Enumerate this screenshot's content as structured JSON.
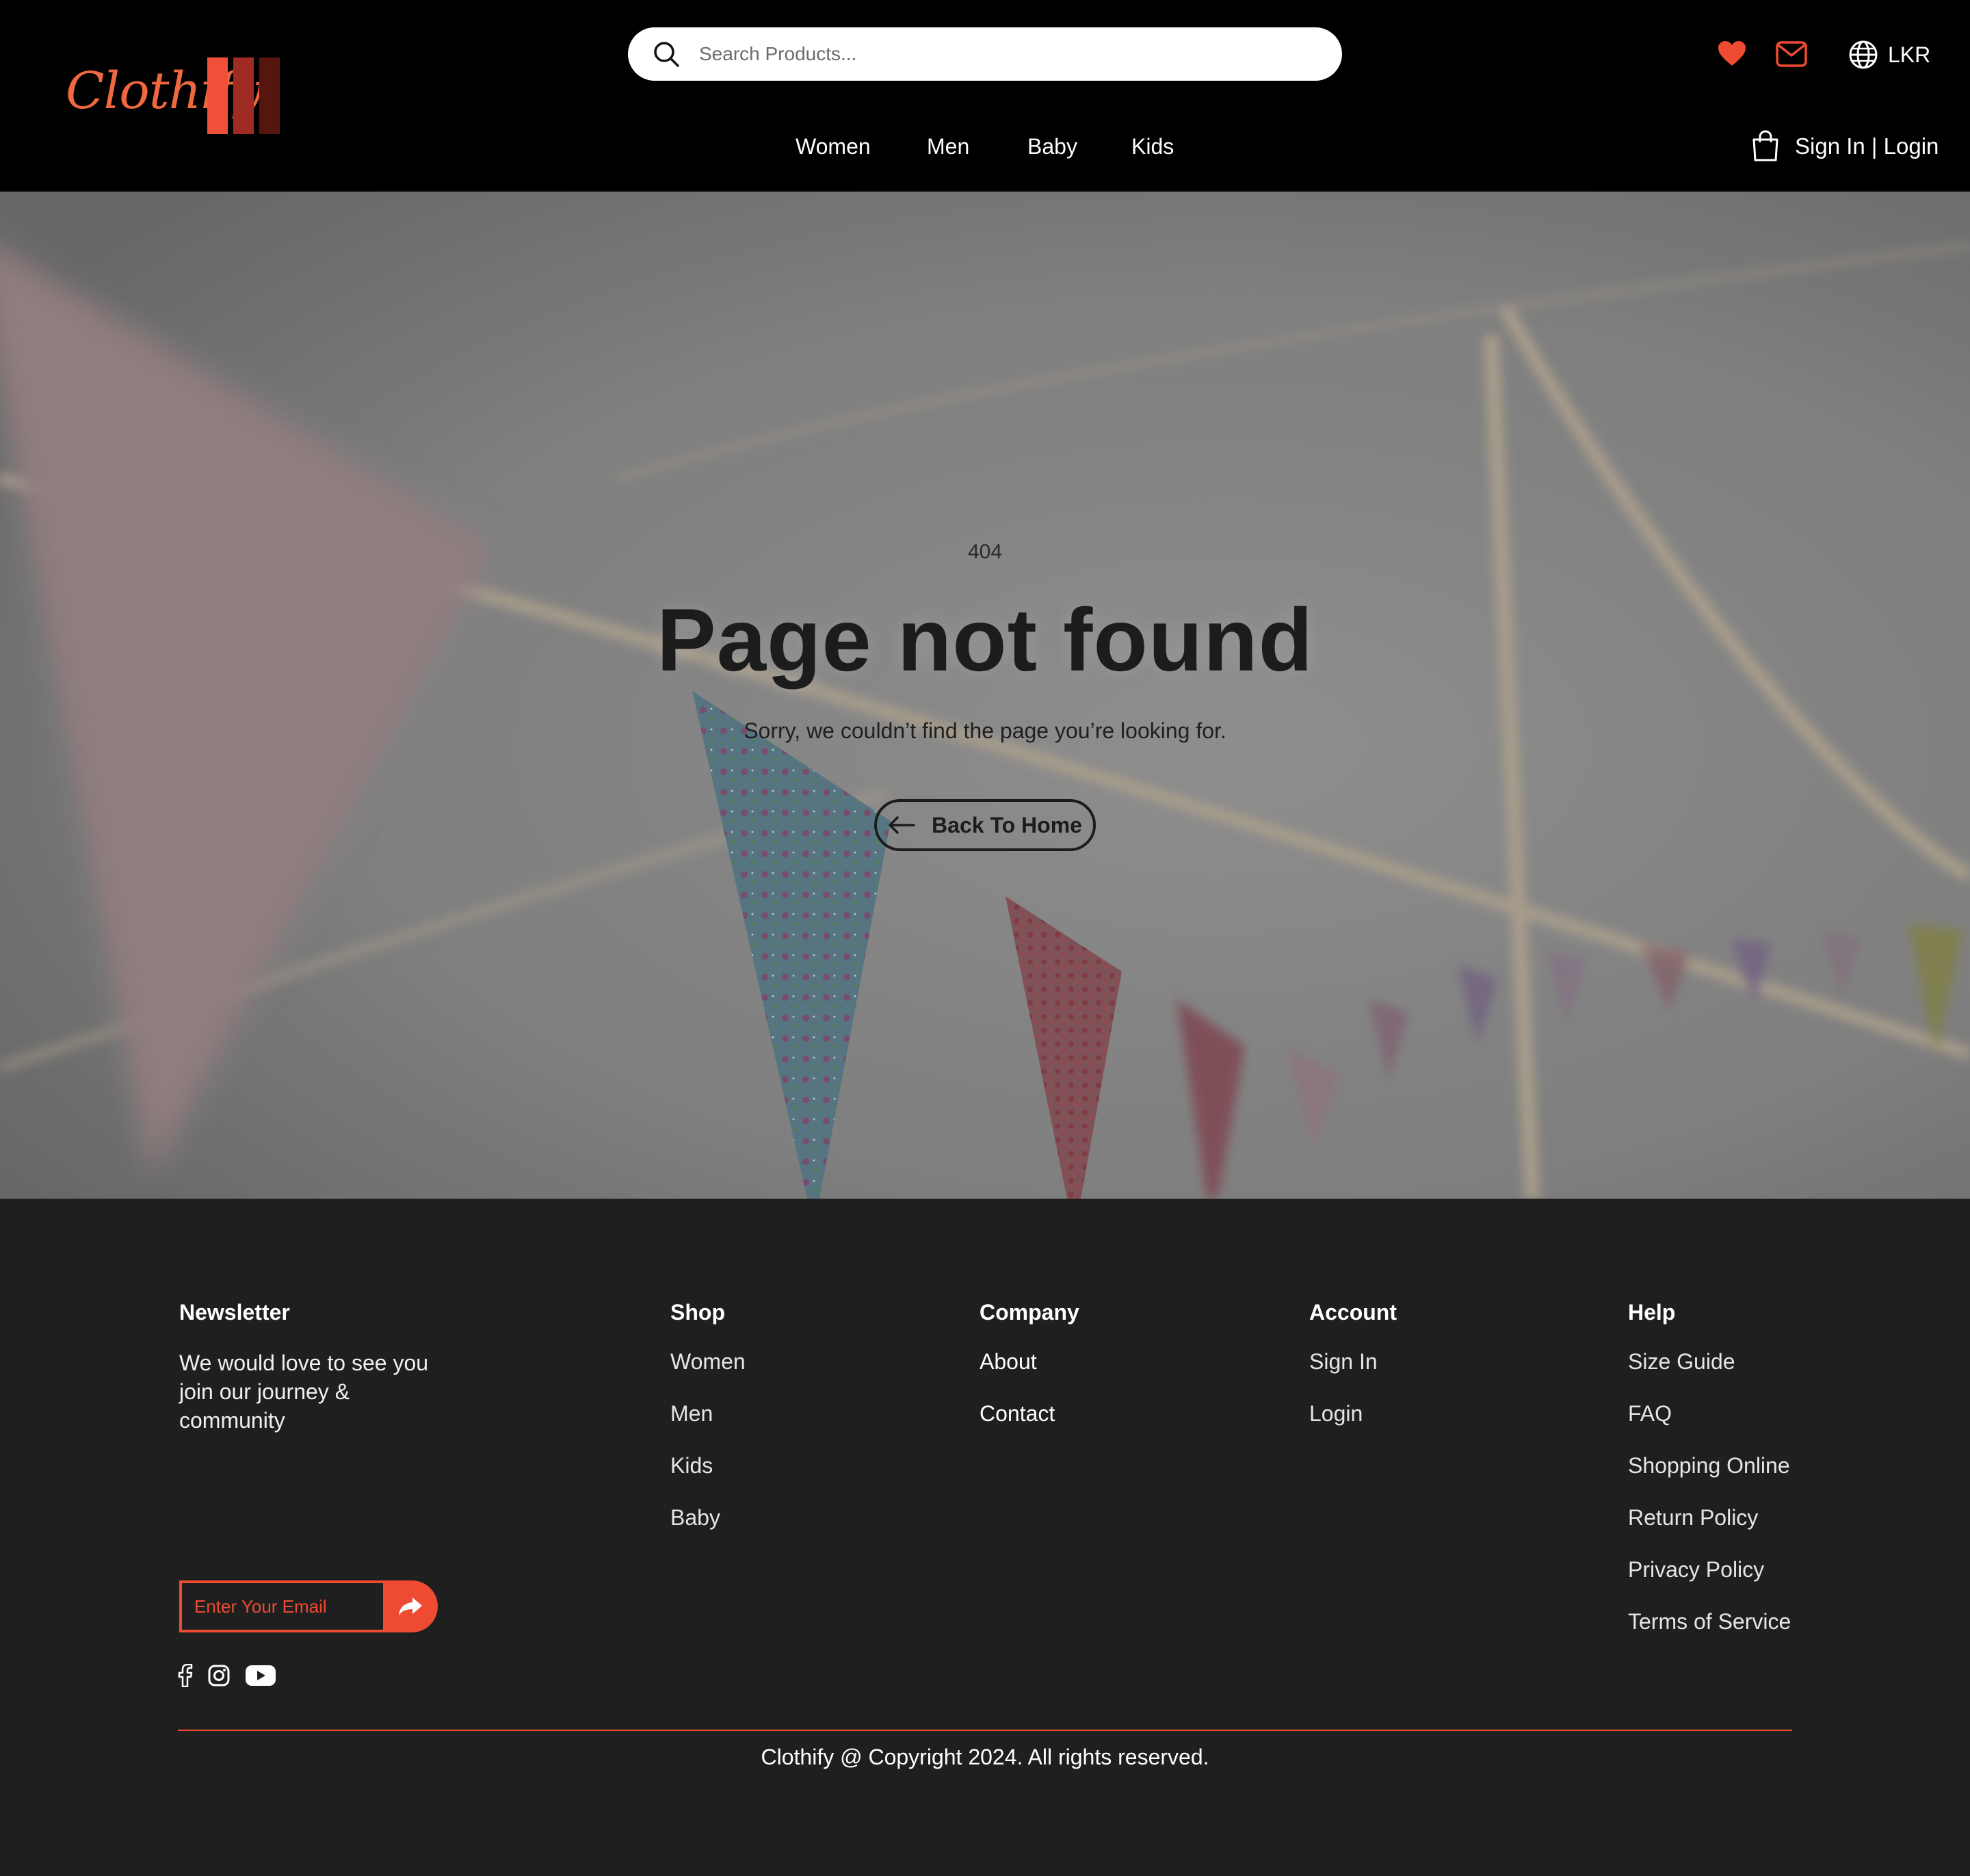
{
  "brand": {
    "name": "Clothify",
    "colors": {
      "accent": "#ef4b32",
      "logo_text": "#f0683f",
      "bar1": "#f0503a",
      "bar2": "#a02b22",
      "bar3": "#55160f"
    }
  },
  "header": {
    "search": {
      "placeholder": "Search Products...",
      "icon": "search-icon"
    },
    "icons": [
      "heart-icon",
      "mail-icon",
      "globe-icon",
      "shopping-bag-icon"
    ],
    "currency": "LKR",
    "nav": [
      "Women",
      "Men",
      "Baby",
      "Kids"
    ],
    "auth_label": "Sign In | Login"
  },
  "hero": {
    "code": "404",
    "title": "Page not found",
    "message": "Sorry, we couldn’t find the page you’re looking for.",
    "button_label": "Back To Home"
  },
  "footer": {
    "newsletter": {
      "title": "Newsletter",
      "text": "We would love to see you join our journey & community",
      "email_placeholder": "Enter Your Email"
    },
    "shop": {
      "title": "Shop",
      "links": [
        "Women",
        "Men",
        "Kids",
        "Baby"
      ]
    },
    "company": {
      "title": "Company",
      "links": [
        "About",
        "Contact"
      ]
    },
    "account": {
      "title": "Account",
      "links": [
        "Sign In",
        "Login"
      ]
    },
    "help": {
      "title": "Help",
      "links": [
        "Size Guide",
        "FAQ",
        "Shopping Online",
        "Return Policy",
        "Privacy Policy",
        "Terms of Service"
      ]
    },
    "socials": [
      "facebook-icon",
      "instagram-icon",
      "youtube-icon"
    ],
    "copyright": "Clothify @ Copyright 2024. All rights reserved."
  }
}
